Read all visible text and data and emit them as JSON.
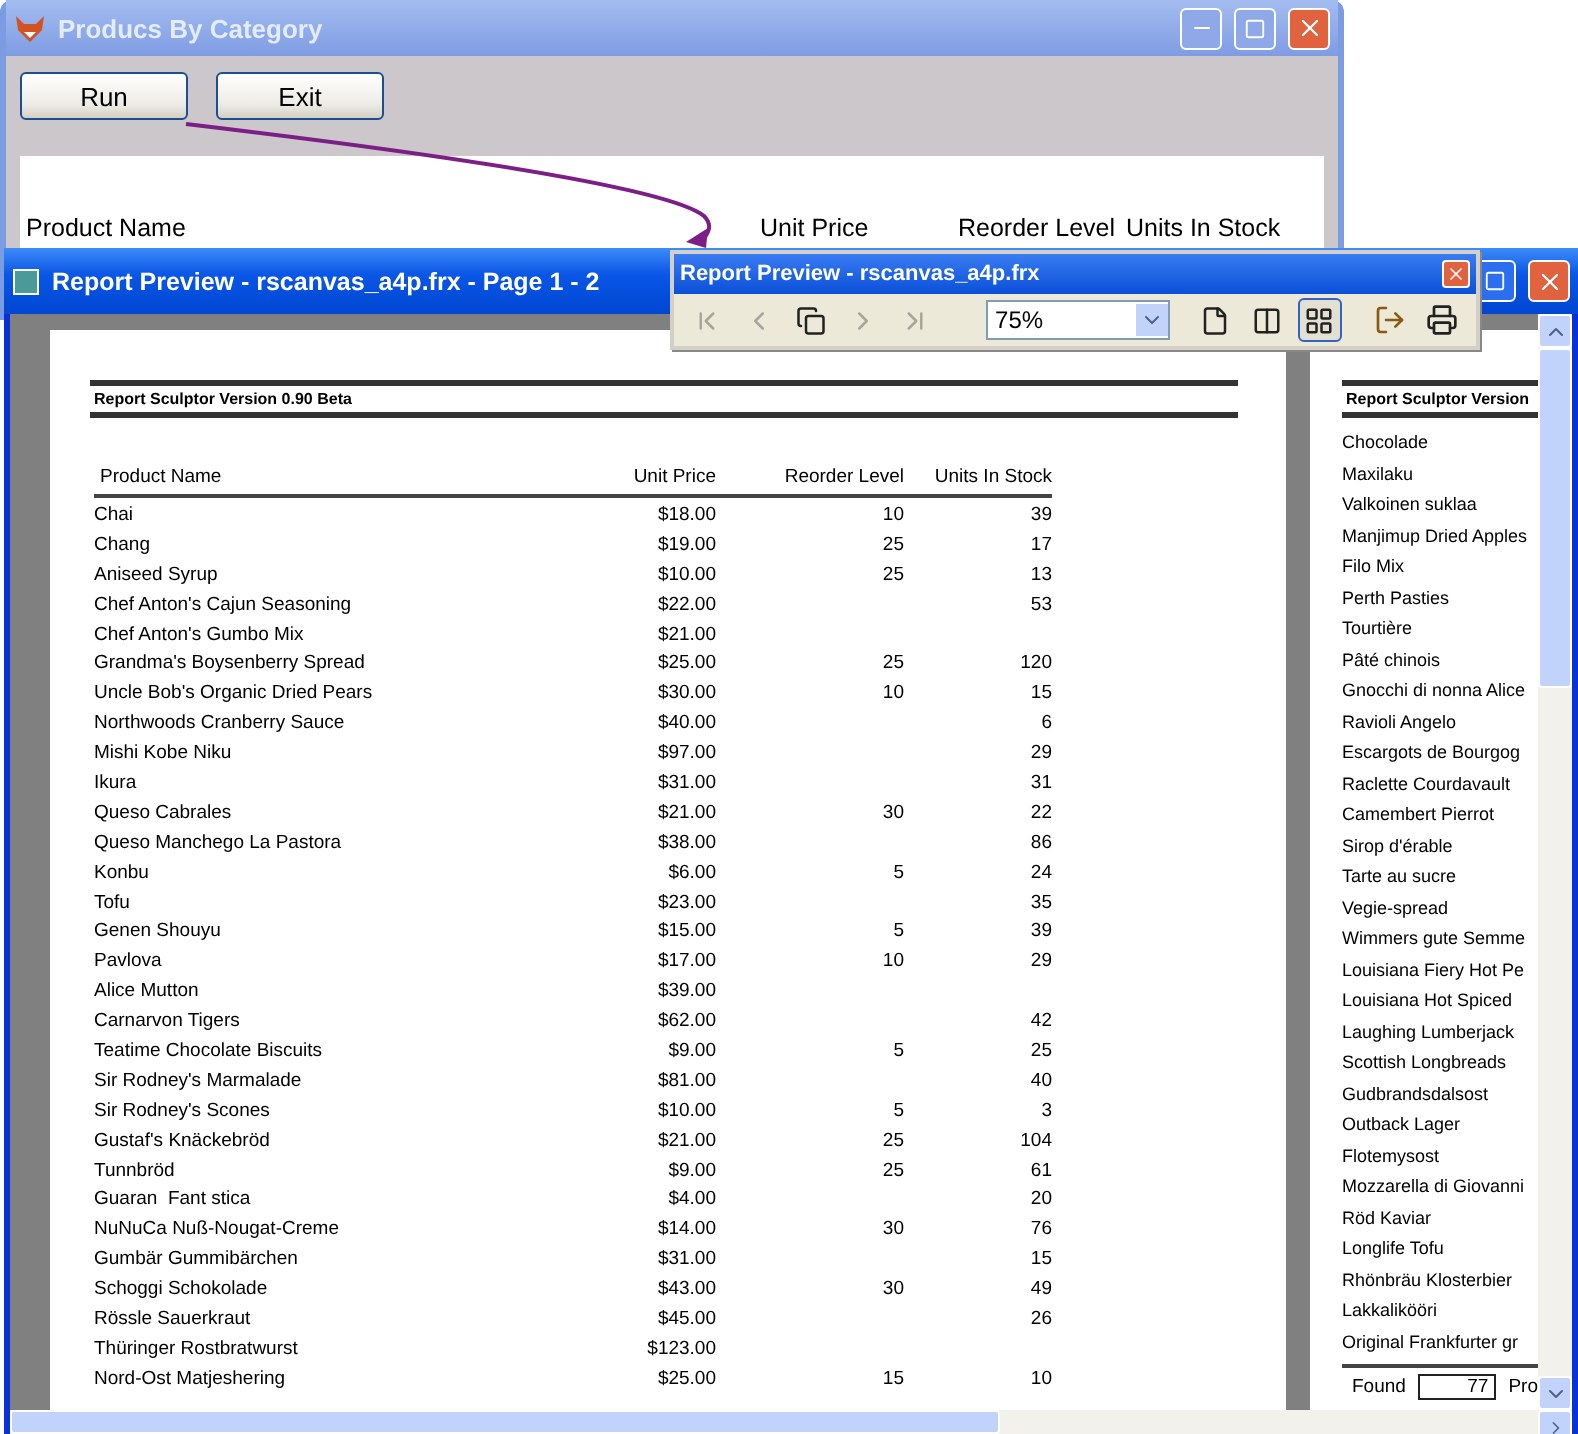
{
  "main_window": {
    "title": "Producs By Category",
    "buttons": [
      "Run",
      "Exit"
    ],
    "columns": [
      "Product Name",
      "Unit Price",
      "Reorder Level",
      "Units In Stock"
    ]
  },
  "preview_window": {
    "title": "Report Preview - rscanvas_a4p.frx - Page 1 - 2",
    "page_1": {
      "header": "Report Sculptor Version 0.90 Beta",
      "columns": [
        "Product Name",
        "Unit Price",
        "Reorder Level",
        "Units In Stock"
      ],
      "rows": [
        {
          "name": "Chai",
          "unit_price": "$18.00",
          "reorder_level": "10",
          "units_in_stock": "39"
        },
        {
          "name": "Chang",
          "unit_price": "$19.00",
          "reorder_level": "25",
          "units_in_stock": "17"
        },
        {
          "name": "Aniseed Syrup",
          "unit_price": "$10.00",
          "reorder_level": "25",
          "units_in_stock": "13"
        },
        {
          "name": "Chef Anton's Cajun Seasoning",
          "unit_price": "$22.00",
          "units_in_stock": "53"
        },
        {
          "name": "Chef Anton's Gumbo Mix",
          "unit_price": "$21.00"
        },
        {
          "name": "Grandma's Boysenberry Spread",
          "unit_price": "$25.00",
          "reorder_level": "25",
          "units_in_stock": "120"
        },
        {
          "name": "Uncle Bob's Organic Dried Pears",
          "unit_price": "$30.00",
          "reorder_level": "10",
          "units_in_stock": "15"
        },
        {
          "name": "Northwoods Cranberry Sauce",
          "unit_price": "$40.00",
          "units_in_stock": "6"
        },
        {
          "name": "Mishi Kobe Niku",
          "unit_price": "$97.00",
          "units_in_stock": "29"
        },
        {
          "name": "Ikura",
          "unit_price": "$31.00",
          "units_in_stock": "31"
        },
        {
          "name": "Queso Cabrales",
          "unit_price": "$21.00",
          "reorder_level": "30",
          "units_in_stock": "22"
        },
        {
          "name": "Queso Manchego La Pastora",
          "unit_price": "$38.00",
          "units_in_stock": "86"
        },
        {
          "name": "Konbu",
          "unit_price": "$6.00",
          "reorder_level": "5",
          "units_in_stock": "24"
        },
        {
          "name": "Tofu",
          "unit_price": "$23.00",
          "units_in_stock": "35"
        },
        {
          "name": "Genen Shouyu",
          "unit_price": "$15.00",
          "reorder_level": "5",
          "units_in_stock": "39"
        },
        {
          "name": "Pavlova",
          "unit_price": "$17.00",
          "reorder_level": "10",
          "units_in_stock": "29"
        },
        {
          "name": "Alice Mutton",
          "unit_price": "$39.00"
        },
        {
          "name": "Carnarvon Tigers",
          "unit_price": "$62.00",
          "units_in_stock": "42"
        },
        {
          "name": "Teatime Chocolate Biscuits",
          "unit_price": "$9.00",
          "reorder_level": "5",
          "units_in_stock": "25"
        },
        {
          "name": "Sir Rodney's Marmalade",
          "unit_price": "$81.00",
          "units_in_stock": "40"
        },
        {
          "name": "Sir Rodney's Scones",
          "unit_price": "$10.00",
          "reorder_level": "5",
          "units_in_stock": "3"
        },
        {
          "name": "Gustaf's Knäckebröd",
          "unit_price": "$21.00",
          "reorder_level": "25",
          "units_in_stock": "104"
        },
        {
          "name": "Tunnbröd",
          "unit_price": "$9.00",
          "reorder_level": "25",
          "units_in_stock": "61"
        },
        {
          "name": "Guaran  Fant stica",
          "unit_price": "$4.00",
          "units_in_stock": "20"
        },
        {
          "name": "NuNuCa Nuß-Nougat-Creme",
          "unit_price": "$14.00",
          "reorder_level": "30",
          "units_in_stock": "76"
        },
        {
          "name": "Gumbär Gummibärchen",
          "unit_price": "$31.00",
          "units_in_stock": "15"
        },
        {
          "name": "Schoggi Schokolade",
          "unit_price": "$43.00",
          "reorder_level": "30",
          "units_in_stock": "49"
        },
        {
          "name": "Rössle Sauerkraut",
          "unit_price": "$45.00",
          "units_in_stock": "26"
        },
        {
          "name": "Thüringer Rostbratwurst",
          "unit_price": "$123.00"
        },
        {
          "name": "Nord-Ost Matjeshering",
          "unit_price": "$25.00",
          "reorder_level": "15",
          "units_in_stock": "10"
        }
      ]
    },
    "page_2": {
      "header": "Report Sculptor Version",
      "names": [
        "Chocolade",
        "Maxilaku",
        "Valkoinen suklaa",
        "Manjimup Dried Apples",
        "Filo Mix",
        "Perth Pasties",
        "Tourtière",
        "Pâté chinois",
        "Gnocchi di nonna Alice",
        "Ravioli Angelo",
        "Escargots de Bourgog",
        "Raclette Courdavault",
        "Camembert Pierrot",
        "Sirop d'érable",
        "Tarte au sucre",
        "Vegie-spread",
        "Wimmers gute Semme",
        "Louisiana Fiery Hot Pe",
        "Louisiana Hot Spiced",
        "Laughing Lumberjack",
        "Scottish Longbreads",
        "Gudbrandsdalsost",
        "Outback Lager",
        "Flotemysost",
        "Mozzarella di Giovanni",
        "Röd Kaviar",
        "Longlife Tofu",
        "Rhönbräu Klosterbier",
        "Lakkalikööri",
        "Original Frankfurter gr"
      ],
      "footer": {
        "label": "Found",
        "value": "77",
        "after": "Pro"
      }
    }
  },
  "toolbar": {
    "title": "Report Preview - rscanvas_a4p.frx",
    "zoom": "75%",
    "nav": [
      {
        "kind": "first",
        "disabled": true
      },
      {
        "kind": "prev",
        "disabled": true
      },
      {
        "kind": "pages",
        "disabled": false
      },
      {
        "kind": "next",
        "disabled": true
      },
      {
        "kind": "last",
        "disabled": true
      }
    ],
    "views": [
      {
        "kind": "one",
        "selected": false
      },
      {
        "kind": "two",
        "selected": false
      },
      {
        "kind": "four",
        "selected": true
      }
    ],
    "actions": [
      {
        "kind": "exit"
      },
      {
        "kind": "print"
      }
    ]
  }
}
